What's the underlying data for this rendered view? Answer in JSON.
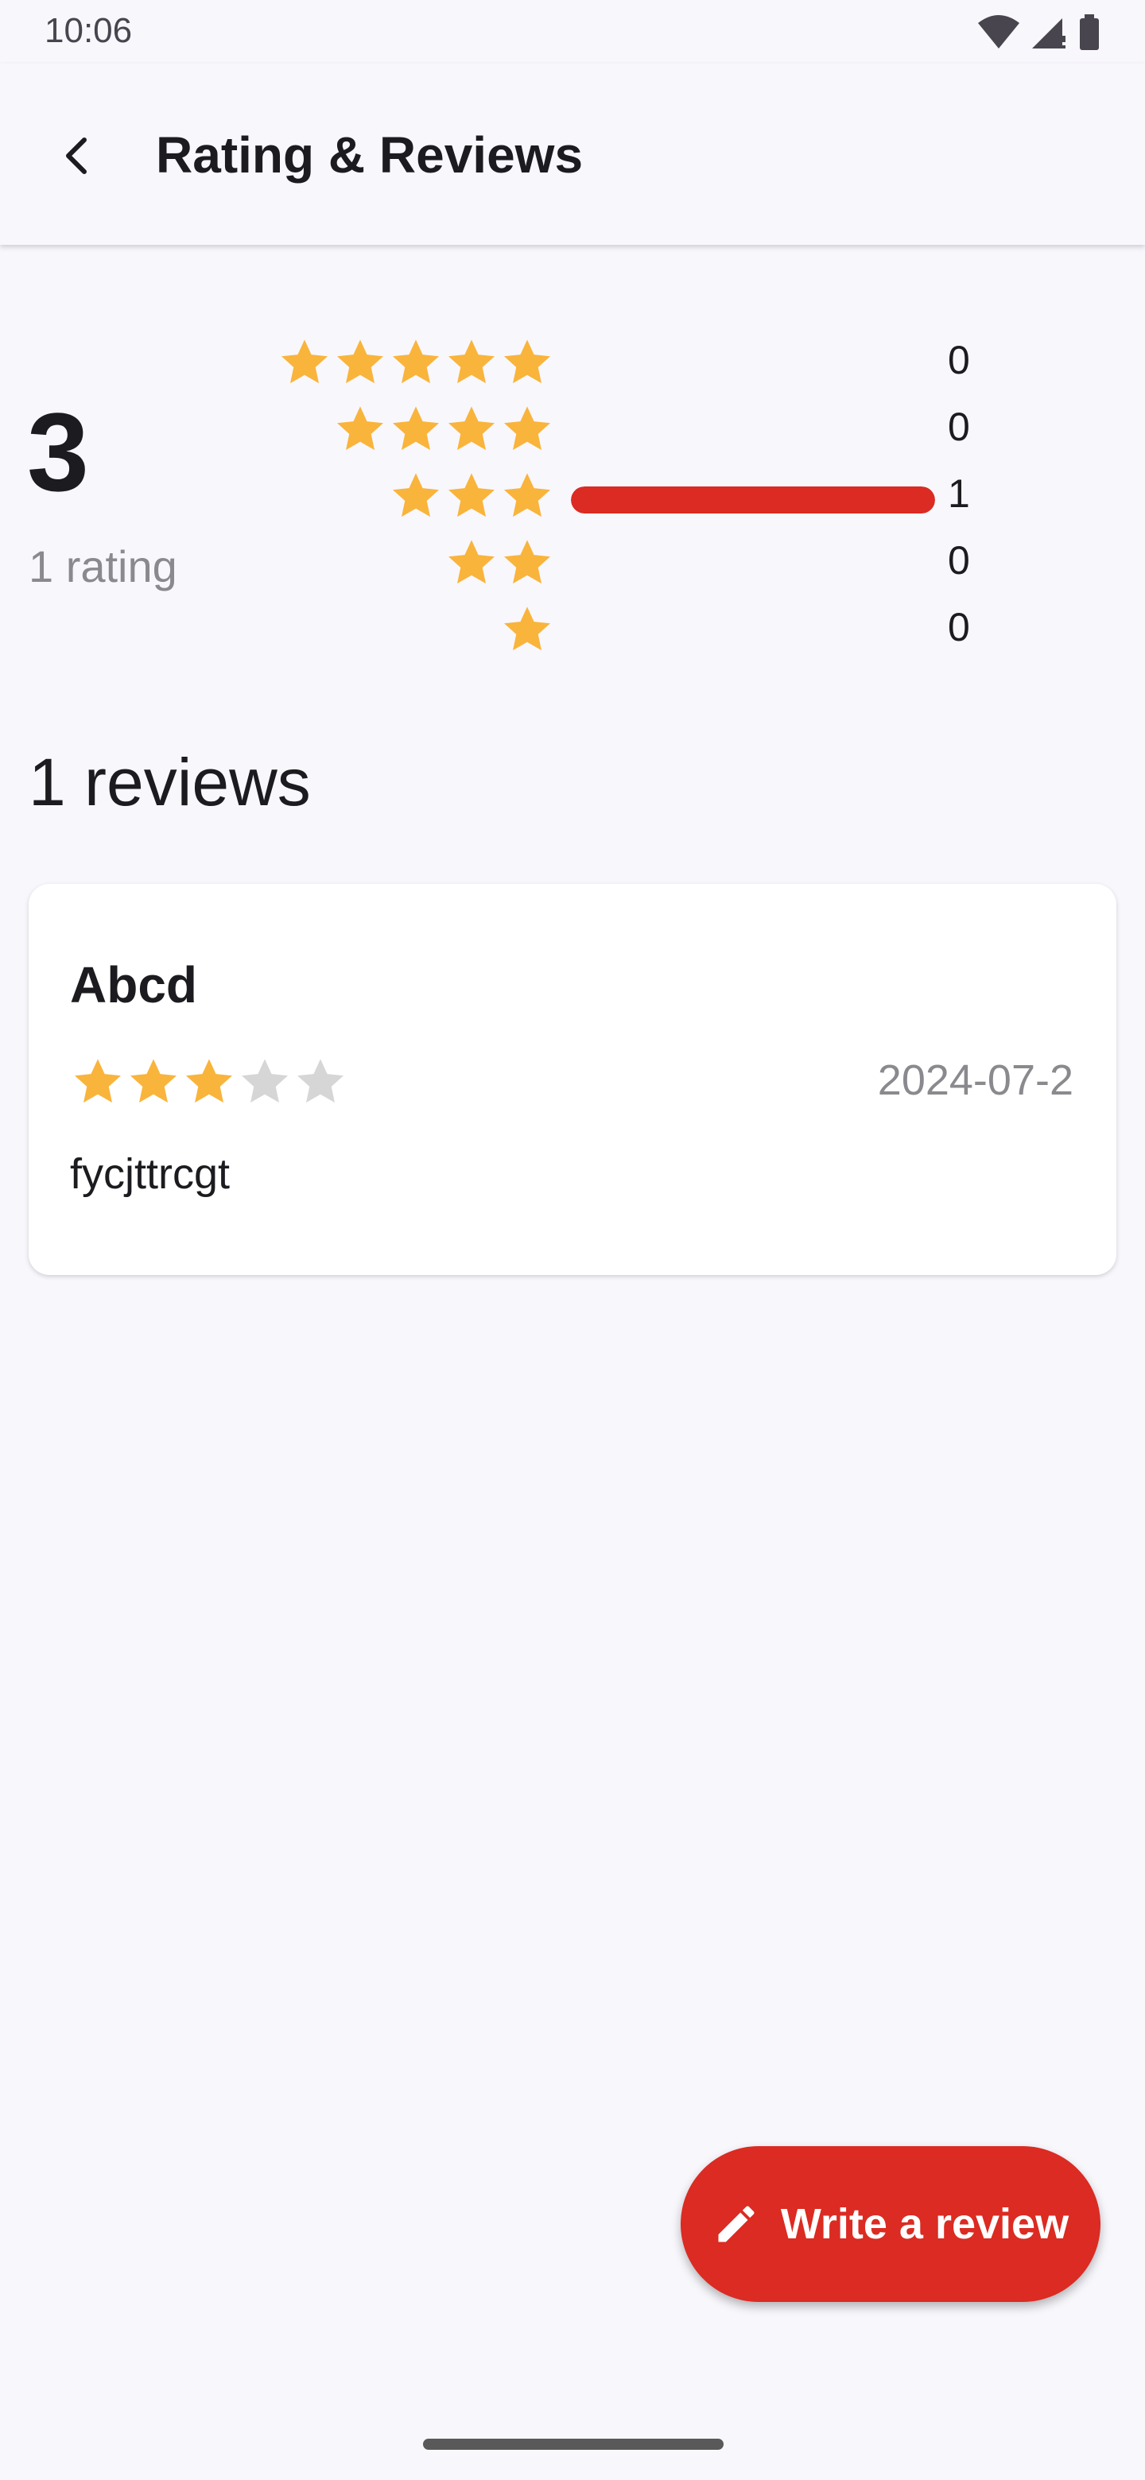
{
  "status_bar": {
    "time": "10:06",
    "icons": [
      "wifi-icon",
      "signal-icon",
      "battery-icon"
    ]
  },
  "app_bar": {
    "title": "Rating & Reviews",
    "back_icon": "arrow-back-icon"
  },
  "summary": {
    "average": "3",
    "rating_count": "1 rating",
    "distribution": [
      {
        "stars": 5,
        "count": "0",
        "fraction": 0
      },
      {
        "stars": 4,
        "count": "0",
        "fraction": 0
      },
      {
        "stars": 3,
        "count": "1",
        "fraction": 1
      },
      {
        "stars": 2,
        "count": "0",
        "fraction": 0
      },
      {
        "stars": 1,
        "count": "0",
        "fraction": 0
      }
    ]
  },
  "reviews_heading": "1 reviews",
  "reviews": [
    {
      "name": "Abcd",
      "rating": 3,
      "max_rating": 5,
      "date": "2024-07-2",
      "text": "fycjttrcgt"
    }
  ],
  "fab": {
    "label": "Write a review",
    "icon": "edit-pencil-icon"
  },
  "colors": {
    "accent": "#db2b22",
    "star_filled": "#f9b43c",
    "star_empty": "#d6d6d6",
    "background": "#f8f7fc"
  }
}
